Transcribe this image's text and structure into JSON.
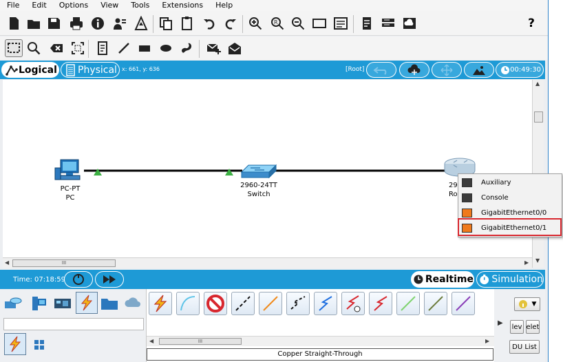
{
  "menu": [
    "File",
    "Edit",
    "Options",
    "View",
    "Tools",
    "Extensions",
    "Help"
  ],
  "help_glyph": "?",
  "workspace": {
    "logical_label": "Logical",
    "physical_label": "Physical",
    "coords": "x: 661, y: 636",
    "root_label": "[Root]",
    "clock": "00:49:30"
  },
  "devices": {
    "pc": {
      "model": "PC-PT",
      "name": "PC"
    },
    "switch": {
      "model": "2960-24TT",
      "name": "Switch"
    },
    "router": {
      "model": "29",
      "name": "Ro"
    }
  },
  "context_menu": {
    "items": [
      {
        "label": "Auxiliary",
        "port_color": "dark"
      },
      {
        "label": "Console",
        "port_color": "dark"
      },
      {
        "label": "GigabitEthernet0/0",
        "port_color": "orange"
      },
      {
        "label": "GigabitEthernet0/1",
        "port_color": "orange",
        "highlighted": true
      }
    ]
  },
  "scroll_thumb_text": "III",
  "timebar": {
    "time": "Time: 07:18:59",
    "realtime_label": "Realtime",
    "simulation_label": "Simulation"
  },
  "connections": {
    "selected_cable": "Copper Straight-Through"
  },
  "right_panel": {
    "btn_dev": "lev",
    "btn_del": "elet",
    "btn_pdu": "DU List"
  },
  "colors": {
    "accent_blue": "#1e9ad6",
    "link_green": "#3cb043",
    "highlight_red": "#d8272e",
    "port_orange": "#f07a1c"
  }
}
